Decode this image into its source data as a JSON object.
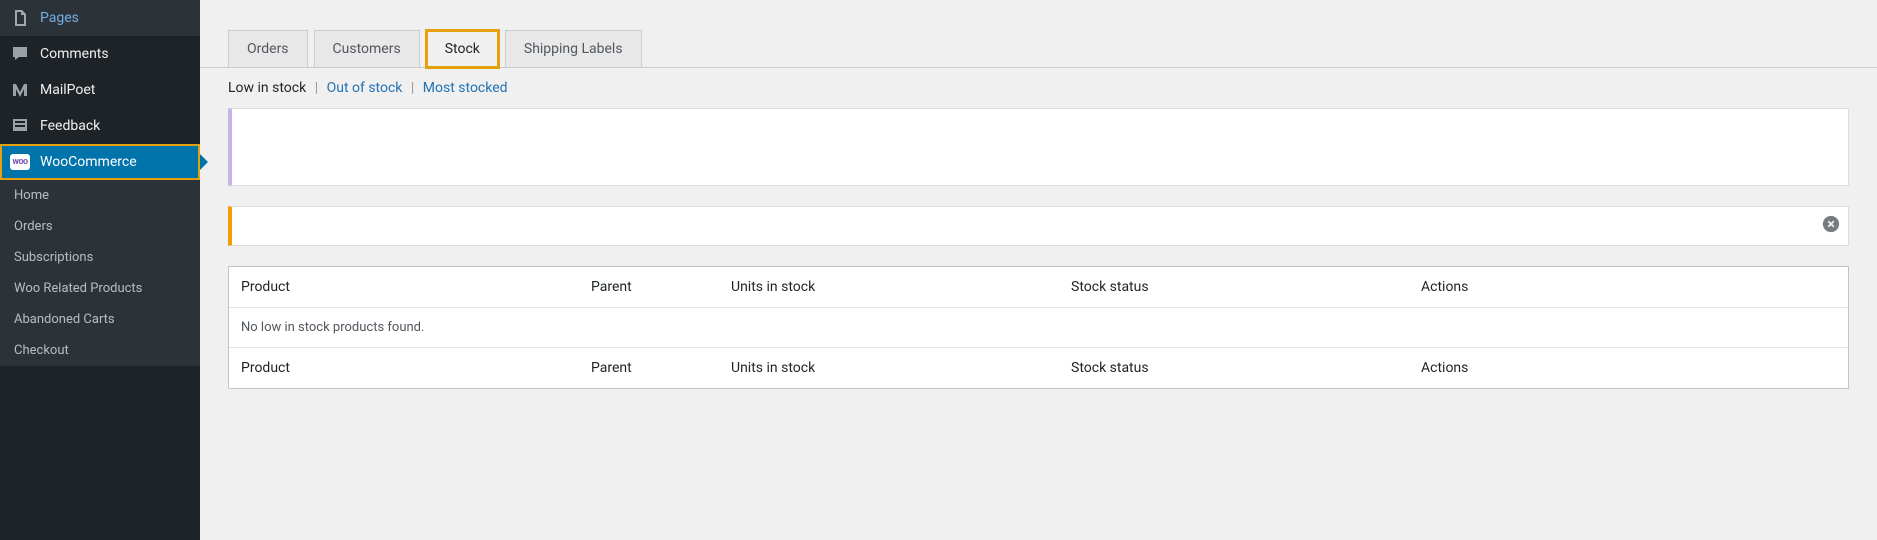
{
  "sidebar": {
    "main_items": [
      {
        "id": "pages",
        "label": "Pages",
        "icon": "pages"
      },
      {
        "id": "comments",
        "label": "Comments",
        "icon": "comments"
      },
      {
        "id": "mailpoet",
        "label": "MailPoet",
        "icon": "mailpoet"
      },
      {
        "id": "feedback",
        "label": "Feedback",
        "icon": "feedback"
      },
      {
        "id": "woocommerce",
        "label": "WooCommerce",
        "icon": "woo",
        "active": true
      }
    ],
    "sub_items": [
      {
        "id": "home",
        "label": "Home"
      },
      {
        "id": "orders",
        "label": "Orders"
      },
      {
        "id": "subscriptions",
        "label": "Subscriptions"
      },
      {
        "id": "woo-related",
        "label": "Woo Related Products"
      },
      {
        "id": "abandoned",
        "label": "Abandoned Carts"
      },
      {
        "id": "checkout",
        "label": "Checkout"
      }
    ]
  },
  "tabs": [
    {
      "id": "orders",
      "label": "Orders"
    },
    {
      "id": "customers",
      "label": "Customers"
    },
    {
      "id": "stock",
      "label": "Stock",
      "active": true,
      "highlighted": true
    },
    {
      "id": "shipping",
      "label": "Shipping Labels"
    }
  ],
  "subtabs": [
    {
      "id": "low",
      "label": "Low in stock",
      "active": true
    },
    {
      "id": "out",
      "label": "Out of stock"
    },
    {
      "id": "most",
      "label": "Most stocked"
    }
  ],
  "table": {
    "columns": {
      "product": "Product",
      "parent": "Parent",
      "units": "Units in stock",
      "status": "Stock status",
      "actions": "Actions"
    },
    "empty_message": "No low in stock products found."
  }
}
